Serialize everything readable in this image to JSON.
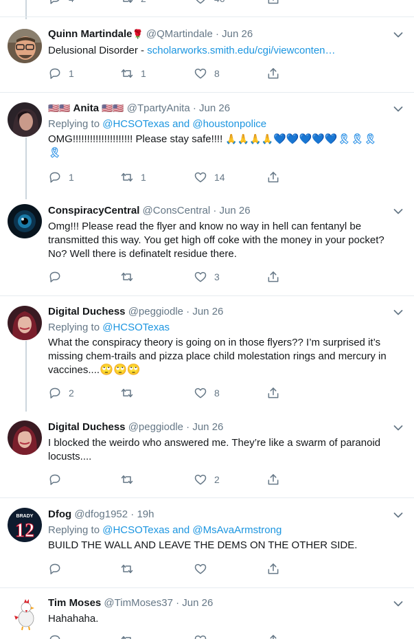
{
  "top_partial": {
    "reply_count": "4",
    "retweet_count": "2",
    "like_count": "46"
  },
  "tweets": [
    {
      "name": "Quinn Martindale",
      "name_suffix": "🌹",
      "handle": "@QMartindale",
      "sep": "·",
      "time": "Jun 26",
      "text": "Delusional Disorder - ",
      "link": "scholarworks.smith.edu/cgi/viewconten…",
      "reply_count": "1",
      "retweet_count": "1",
      "like_count": "8"
    },
    {
      "name_prefix": "🇺🇸🇺🇸",
      "name": "Anita",
      "name_suffix": "🇺🇸🇺🇸",
      "handle": "@TpartyAnita",
      "sep": "·",
      "time": "Jun 26",
      "replying_label": "Replying to",
      "replying_1": "@HCSOTexas",
      "replying_and": "and",
      "replying_2": "@houstonpolice",
      "text": "OMG!!!!!!!!!!!!!!!!!!!!! Please stay safe!!!! ",
      "emoji_pray": "🙏🙏🙏🙏",
      "emoji_hearts": "💙💙💙💙💙",
      "emoji_ribbons": "🎗🎗🎗",
      "emoji_ribbon_last": "🎗",
      "reply_count": "1",
      "retweet_count": "1",
      "like_count": "14"
    },
    {
      "name": "ConspiracyCentral",
      "handle": "@ConsCentral",
      "sep": "·",
      "time": "Jun 26",
      "text": "Omg!!! Please read the flyer and know no way in hell can fentanyl be transmitted this way.  You get high off coke with the money in your pocket? No? Well there is definatelt residue there.",
      "reply_count": "",
      "retweet_count": "",
      "like_count": "3"
    },
    {
      "name": "Digital Duchess",
      "handle": "@peggiodle",
      "sep": "·",
      "time": "Jun 26",
      "replying_label": "Replying to",
      "replying_1": "@HCSOTexas",
      "text": "What the conspiracy theory is going on in those flyers?? I’m surprised it’s missing chem-trails and pizza place child molestation rings and mercury in vaccines....",
      "emoji_faces": "🙄🙄🙄",
      "reply_count": "2",
      "retweet_count": "",
      "like_count": "8"
    },
    {
      "name": "Digital Duchess",
      "handle": "@peggiodle",
      "sep": "·",
      "time": "Jun 26",
      "text": "I blocked the weirdo who answered me. They’re like a swarm of paranoid locusts....",
      "reply_count": "",
      "retweet_count": "",
      "like_count": "2"
    },
    {
      "name": "Dfog",
      "handle": "@dfog1952",
      "sep": "·",
      "time": "19h",
      "avatar_text_top": "BRADY",
      "avatar_text_num": "12",
      "replying_label": "Replying to",
      "replying_1": "@HCSOTexas",
      "replying_and": "and",
      "replying_2": "@MsAvaArmstrong",
      "text": "BUILD THE WALL AND LEAVE THE DEMS ON THE OTHER SIDE.",
      "reply_count": "",
      "retweet_count": "",
      "like_count": ""
    },
    {
      "name": "Tim Moses",
      "handle": "@TimMoses37",
      "sep": "·",
      "time": "Jun 26",
      "text": "Hahahaha.",
      "reply_count": "",
      "retweet_count": "",
      "like_count": ""
    }
  ],
  "colors": {
    "link": "#1b95e0",
    "secondary_text": "#657786",
    "primary_text": "#14171a",
    "separator": "#e6ecf0",
    "thread_line": "#ccd6dd"
  },
  "icons": {
    "reply": "reply-icon",
    "retweet": "retweet-icon",
    "like": "heart-icon",
    "share": "share-icon",
    "more": "chevron-down-icon"
  }
}
